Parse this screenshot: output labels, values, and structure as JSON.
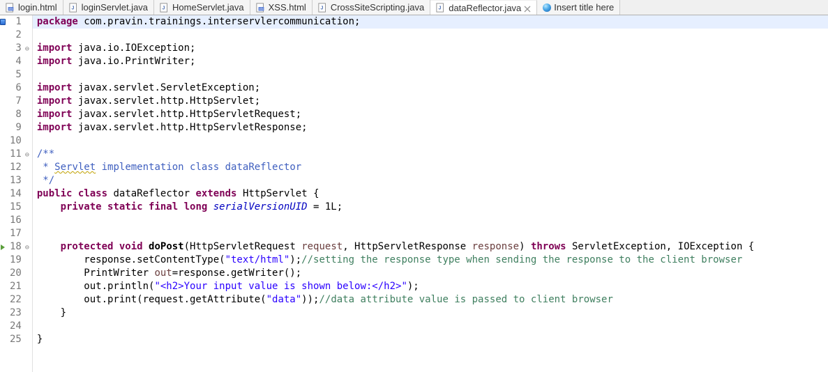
{
  "tabs": [
    {
      "icon": "html",
      "label": "login.html",
      "active": false
    },
    {
      "icon": "java",
      "label": "loginServlet.java",
      "active": false
    },
    {
      "icon": "java",
      "label": "HomeServlet.java",
      "active": false
    },
    {
      "icon": "html",
      "label": "XSS.html",
      "active": false
    },
    {
      "icon": "java",
      "label": "CrossSiteScripting.java",
      "active": false
    },
    {
      "icon": "java",
      "label": "dataReflector.java",
      "active": true
    },
    {
      "icon": "globe",
      "label": "Insert title here",
      "active": false
    }
  ],
  "gutter": [
    "mark",
    "",
    "fold",
    "",
    "",
    "",
    "",
    "",
    "",
    "",
    "fold",
    "",
    "",
    "",
    "",
    "",
    "",
    "trifold",
    "",
    "",
    "",
    "",
    "",
    "",
    ""
  ],
  "linenums": [
    "1",
    "2",
    "3",
    "4",
    "5",
    "6",
    "7",
    "8",
    "9",
    "10",
    "11",
    "12",
    "13",
    "14",
    "15",
    "16",
    "17",
    "18",
    "19",
    "20",
    "21",
    "22",
    "23",
    "24",
    "25"
  ],
  "code": {
    "l1": {
      "kw": "package",
      "rest": " com.pravin.trainings.interservlercommunication;"
    },
    "l3": {
      "kw": "import",
      "rest": " java.io.IOException;"
    },
    "l4": {
      "kw": "import",
      "rest": " java.io.PrintWriter;"
    },
    "l6": {
      "kw": "import",
      "rest": " javax.servlet.ServletException;"
    },
    "l7": {
      "kw": "import",
      "rest": " javax.servlet.http.HttpServlet;"
    },
    "l8": {
      "kw": "import",
      "rest": " javax.servlet.http.HttpServletRequest;"
    },
    "l9": {
      "kw": "import",
      "rest": " javax.servlet.http.HttpServletResponse;"
    },
    "l11": "/**",
    "l12a": " * ",
    "l12b": "Servlet",
    "l12c": " implementation class dataReflector",
    "l13": " */",
    "l14": {
      "kw1": "public",
      "kw2": "class",
      "name": "dataReflector",
      "kw3": "extends",
      "sup": "HttpServlet"
    },
    "l15": {
      "kw": "private static final long",
      "fld": "serialVersionUID",
      "rest": " = 1L;"
    },
    "l18": {
      "kw1": "protected",
      "kw2": "void",
      "mth": "doPost",
      "sig1": "(HttpServletRequest ",
      "p1": "request",
      "sig2": ", HttpServletResponse ",
      "p2": "response",
      "sig3": ") ",
      "kw3": "throws",
      "exc": " ServletException, IOException {"
    },
    "l19": {
      "a": "        response.setContentType(",
      "s": "\"text/html\"",
      "b": ");",
      "c": "//setting the response type when sending the response to the client browser"
    },
    "l20": {
      "a": "        PrintWriter ",
      "v": "out",
      "b": "=response.getWriter();"
    },
    "l21": {
      "a": "        out.println(",
      "s": "\"<h2>Your input value is shown below:</h2>\"",
      "b": ");"
    },
    "l22": {
      "a": "        out.print(request.getAttribute(",
      "s": "\"data\"",
      "b": "));",
      "c": "//data attribute value is passed to client browser"
    },
    "l23": "    }",
    "l25": "}"
  }
}
